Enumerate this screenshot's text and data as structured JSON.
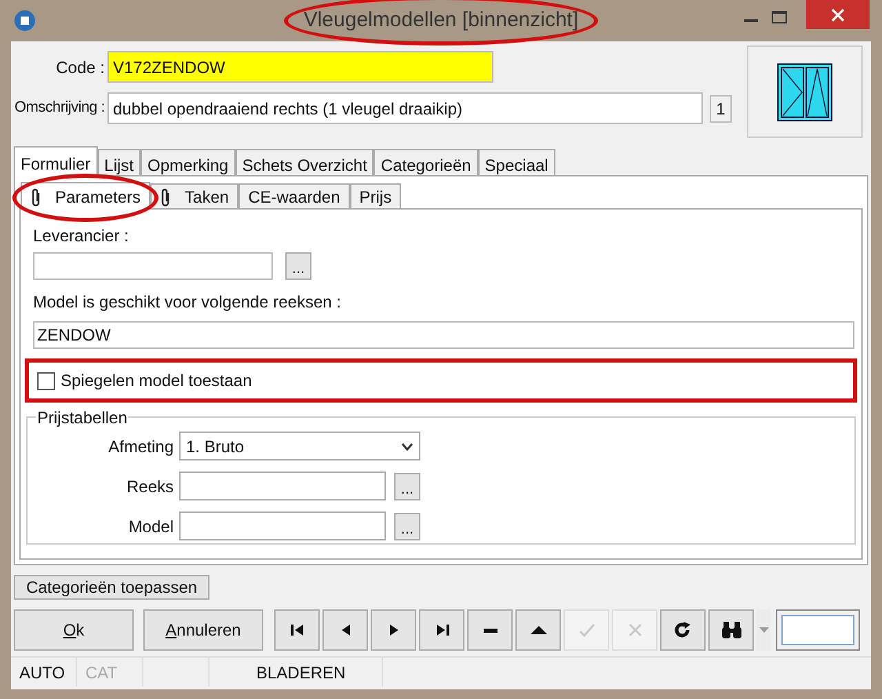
{
  "window": {
    "title": "Vleugelmodellen [binnenzicht]",
    "title_annotated": true
  },
  "header": {
    "code_label": "Code :",
    "code_value": "V172ZENDOW",
    "description_label": "Omschrijving :",
    "description_value": "dubbel opendraaiend rechts (1 vleugel draaikip)",
    "count": "1"
  },
  "tabs": [
    {
      "label": "Formulier",
      "selected": true
    },
    {
      "label": "Lijst",
      "selected": false
    },
    {
      "label": "Opmerking",
      "selected": false
    },
    {
      "label": "Schets Overzicht",
      "selected": false
    },
    {
      "label": "Categorieën",
      "selected": false
    },
    {
      "label": "Speciaal",
      "selected": false
    }
  ],
  "subtabs": [
    {
      "label": "Parameters",
      "selected": true,
      "clip": true,
      "annotated": true
    },
    {
      "label": "Taken",
      "selected": false,
      "clip": true,
      "annotated": false
    },
    {
      "label": "CE-waarden",
      "selected": false,
      "clip": false,
      "annotated": false
    },
    {
      "label": "Prijs",
      "selected": false,
      "clip": false,
      "annotated": false
    }
  ],
  "leverancier": {
    "label": "Leverancier :",
    "browse": "..."
  },
  "series": {
    "label": "Model is geschikt voor volgende reeksen :",
    "value": "ZENDOW"
  },
  "mirror": {
    "label": "Spiegelen model toestaan",
    "checked": false,
    "annotated": true
  },
  "price_tables": {
    "title": "Prijstabellen",
    "rows": [
      {
        "kind": "select",
        "label": "Afmeting",
        "value": "1.  Bruto"
      },
      {
        "kind": "browse",
        "label": "Reeks",
        "browse": "..."
      },
      {
        "kind": "browse",
        "label": "Model",
        "browse": "..."
      }
    ]
  },
  "apply_button": "Categorieën toepassen",
  "buttons": [
    {
      "label": "Ok"
    },
    {
      "label": "Annuleren"
    }
  ],
  "nav": [
    {
      "kind": "first",
      "disabled": false
    },
    {
      "kind": "prev",
      "disabled": false
    },
    {
      "kind": "next",
      "disabled": false
    },
    {
      "kind": "last",
      "disabled": false
    },
    {
      "kind": "minus",
      "disabled": false
    },
    {
      "kind": "up",
      "disabled": false
    },
    {
      "kind": "check",
      "disabled": true
    },
    {
      "kind": "cancel",
      "disabled": true
    },
    {
      "kind": "refresh",
      "disabled": false
    },
    {
      "kind": "find",
      "disabled": false
    }
  ],
  "status_bar": [
    {
      "text": "AUTO",
      "disabled": false
    },
    {
      "text": "CAT",
      "disabled": true
    },
    {
      "text": "BLADEREN",
      "disabled": false
    }
  ]
}
